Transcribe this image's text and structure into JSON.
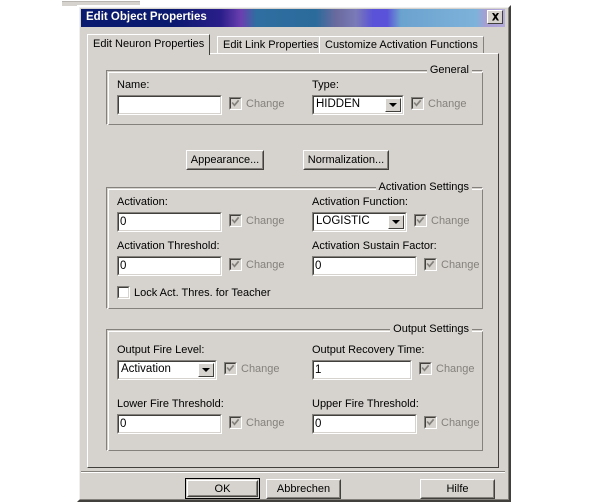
{
  "window": {
    "title": "Edit Object Properties",
    "close_icon": "close-icon",
    "titlebar_start_color": "#0a1a6e",
    "titlebar_end_color": "#aed8f2",
    "face_color": "#d6d3ce"
  },
  "tabs": [
    {
      "label": "Edit Neuron Properties",
      "selected": true
    },
    {
      "label": "Edit Link Properties",
      "selected": false
    },
    {
      "label": "Customize Activation Functions",
      "selected": false
    }
  ],
  "groups": {
    "general": {
      "legend": "General",
      "fields": {
        "name": {
          "label": "Name:",
          "value": "",
          "placeholder": ""
        },
        "type": {
          "label": "Type:",
          "value": "HIDDEN"
        }
      },
      "change_label": "Change",
      "change_checked": true,
      "change_disabled": true
    },
    "activation": {
      "legend": "Activation Settings",
      "fields": {
        "activation": {
          "label": "Activation:",
          "value": "0"
        },
        "activation_function": {
          "label": "Activation Function:",
          "value": "LOGISTIC"
        },
        "activation_threshold": {
          "label": "Activation Threshold:",
          "value": "0"
        },
        "activation_sustain_factor": {
          "label": "Activation Sustain Factor:",
          "value": "0"
        }
      },
      "change_label": "Change",
      "lock_checkbox": {
        "label": "Lock Act. Thres. for Teacher",
        "checked": false
      }
    },
    "output": {
      "legend": "Output Settings",
      "fields": {
        "output_fire_level": {
          "label": "Output Fire Level:",
          "value": "Activation"
        },
        "output_recovery_time": {
          "label": "Output Recovery Time:",
          "value": "1"
        },
        "lower_fire_threshold": {
          "label": "Lower Fire Threshold:",
          "value": "0"
        },
        "upper_fire_threshold": {
          "label": "Upper Fire Threshold:",
          "value": "0"
        }
      },
      "change_label": "Change"
    }
  },
  "mid_buttons": {
    "appearance": "Appearance...",
    "normalization": "Normalization..."
  },
  "footer_buttons": {
    "ok": "OK",
    "cancel": "Abbrechen",
    "help": "Hilfe"
  }
}
